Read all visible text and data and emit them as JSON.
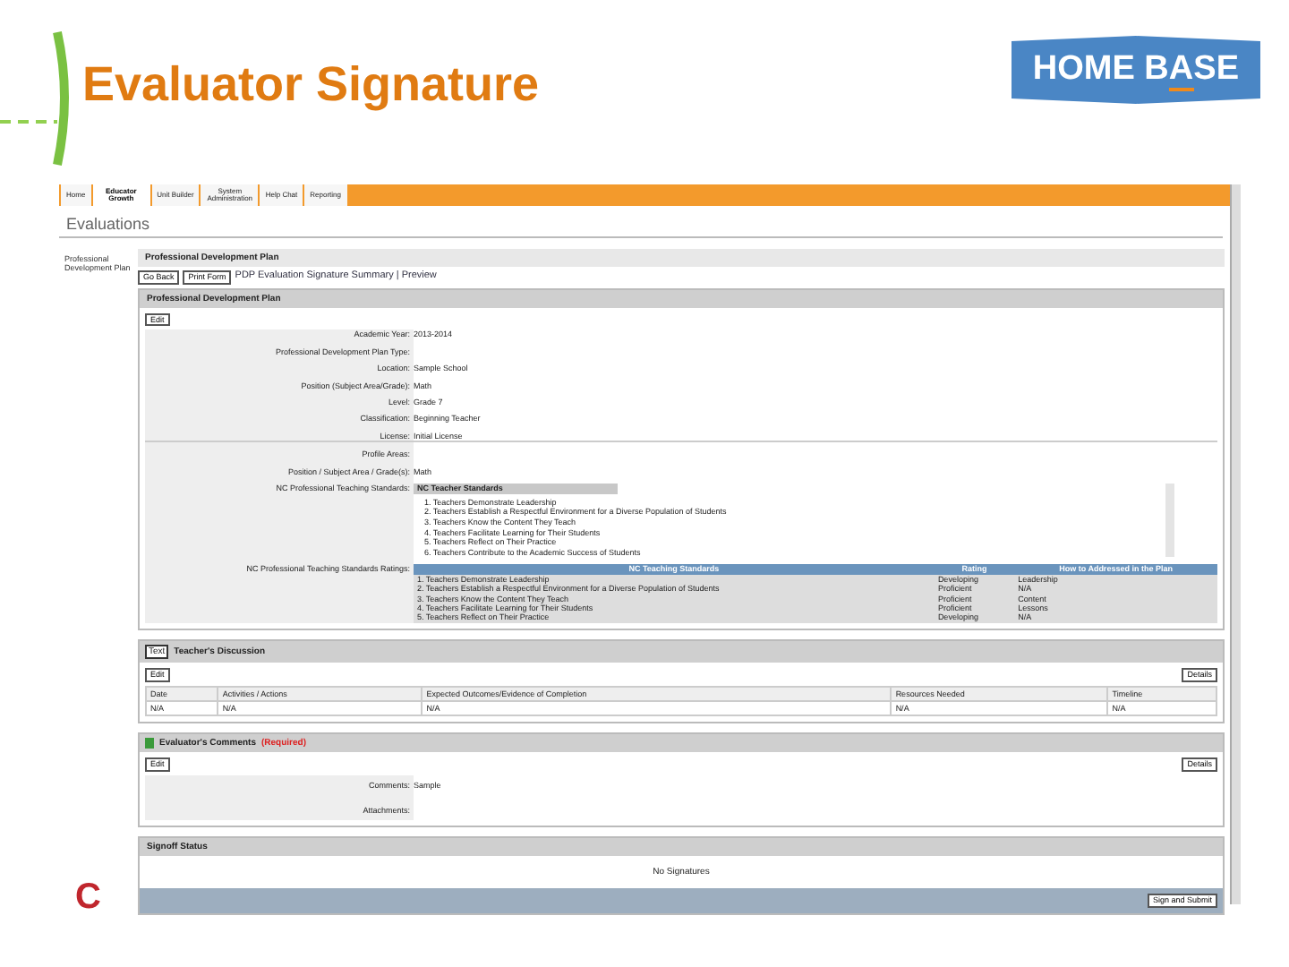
{
  "slide": {
    "title": "Evaluator Signature",
    "logo": {
      "left": "HOME B",
      "mid": "A",
      "right": "SE"
    },
    "corner_letter": "C"
  },
  "app": {
    "tabs": [
      {
        "label": "Home",
        "selected": false
      },
      {
        "label": "Educator Growth",
        "selected": true
      },
      {
        "label": "Unit Builder",
        "selected": false
      },
      {
        "label": "System Administration",
        "selected": false
      },
      {
        "label": "Help Chat",
        "selected": false
      },
      {
        "label": "Reporting",
        "selected": false
      }
    ],
    "heading": "Evaluations",
    "sidebar": [
      "Professional Development Plan"
    ],
    "section_title": "Professional Development Plan",
    "buttons": [
      "Go Back",
      "Print Form"
    ],
    "breadcrumb": "PDP Evaluation Signature Summary | Preview",
    "plan": {
      "title": "Professional Development Plan",
      "edit": "Edit",
      "fields": [
        {
          "label": "Academic Year:",
          "value": "2013-2014"
        },
        {
          "label": "Professional Development Plan Type:"
        },
        {
          "label": "Location:",
          "value": "Sample School"
        },
        {
          "label": "Position (Subject Area/Grade):",
          "value": "Math"
        },
        {
          "label": "Level:",
          "value": "Grade 7"
        },
        {
          "label": "Classification:",
          "value": "Beginning Teacher"
        },
        {
          "label": "License:",
          "value": "Initial License"
        }
      ],
      "fields2": [
        {
          "label": "Profile Areas:"
        },
        {
          "label": "Position / Subject Area / Grade(s):",
          "value": "Math"
        }
      ],
      "standards_label": "NC Professional Teaching Standards:",
      "standards_header": "NC Teacher Standards",
      "standards": [
        "1. Teachers Demonstrate Leadership",
        "2. Teachers Establish a Respectful Environment for a Diverse Population of Students",
        "3. Teachers Know the Content They Teach",
        "4. Teachers Facilitate Learning for Their Students",
        "5. Teachers Reflect on Their Practice",
        "6. Teachers Contribute to the Academic Success of Students"
      ],
      "ratings_label": "NC Professional Teaching Standards Ratings:",
      "ratings_columns": [
        "NC Teaching Standards",
        "Rating",
        "How to Addressed in the Plan"
      ],
      "ratings_rows": [
        [
          "1. Teachers Demonstrate Leadership",
          "Developing",
          "Leadership"
        ],
        [
          "2. Teachers Establish a Respectful Environment for a Diverse Population of Students",
          "Proficient",
          "N/A"
        ],
        [
          "3. Teachers Know the Content They Teach",
          "Proficient",
          "Content"
        ],
        [
          "4. Teachers Facilitate Learning for Their Students",
          "Proficient",
          "Lessons"
        ],
        [
          "5. Teachers Reflect on Their Practice",
          "Developing",
          "N/A"
        ]
      ]
    },
    "discussion": {
      "title": "Teacher's Discussion",
      "tag": "Text",
      "add": "Edit",
      "details": "Details",
      "columns": [
        "Date",
        "Activities / Actions",
        "Expected Outcomes/Evidence of Completion",
        "Resources Needed",
        "Timeline"
      ],
      "row": [
        "N/A",
        "N/A",
        "N/A",
        "N/A",
        "N/A"
      ]
    },
    "comments": {
      "title": "Evaluator's Comments",
      "required": "(Required)",
      "edit": "Edit",
      "details": "Details",
      "fields": [
        {
          "label": "Comments:",
          "value": "Sample"
        },
        {
          "label": "Attachments:"
        }
      ]
    },
    "signoff": {
      "title": "Signoff Status",
      "message": "No Signatures",
      "button": "Sign and Submit"
    }
  }
}
